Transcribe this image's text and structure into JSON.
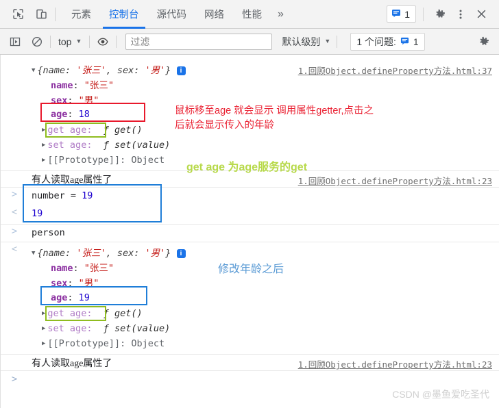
{
  "window": {
    "title": "Chrome DevTools Console"
  },
  "tabbar": {
    "inspect_icon": "inspect-element-icon",
    "device_icon": "device-toolbar-icon",
    "tabs": [
      {
        "label": "元素",
        "active": false
      },
      {
        "label": "控制台",
        "active": true
      },
      {
        "label": "源代码",
        "active": false
      },
      {
        "label": "网络",
        "active": false
      },
      {
        "label": "性能",
        "active": false
      }
    ],
    "more_label": "»",
    "message_count": "1",
    "settings_icon": "gear-icon",
    "menu_icon": "more-vertical-icon",
    "close_icon": "close-icon"
  },
  "filterbar": {
    "sidebar_toggle_icon": "show-console-sidebar-icon",
    "clear_icon": "clear-console-icon",
    "context_label": "top",
    "context_caret": "▼",
    "eye_icon": "live-expression-icon",
    "filter_placeholder": "过滤",
    "filter_value": "",
    "level_label": "默认级别",
    "level_caret": "▼",
    "issues_label": "1 个问题:",
    "issues_count": "1",
    "settings_icon": "gear-icon"
  },
  "console": {
    "entries": [
      {
        "type": "object-output",
        "preview_prefix": "{name: ",
        "preview_name": "'张三'",
        "preview_mid": ", sex: ",
        "preview_sex": "'男'",
        "preview_suffix": "}",
        "source_link": "1.回顾Object.defineProperty方法.html:37",
        "props": [
          {
            "key": "name",
            "sep": ": ",
            "value": "\"张三\"",
            "kind": "string"
          },
          {
            "key": "sex",
            "sep": ": ",
            "value": "\"男\"",
            "kind": "string"
          },
          {
            "key": "age",
            "sep": ": ",
            "value": "18",
            "kind": "number"
          },
          {
            "key": "get age",
            "sep": ": ",
            "value": "ƒ get()",
            "kind": "function"
          },
          {
            "key": "set age",
            "sep": ": ",
            "value": "ƒ set(value)",
            "kind": "function"
          },
          {
            "key": "[[Prototype]]",
            "sep": ": ",
            "value": "Object",
            "kind": "proto"
          }
        ]
      },
      {
        "type": "log",
        "text": "有人读取age属性了",
        "source_link": "1.回顾Object.defineProperty方法.html:23"
      },
      {
        "type": "input",
        "text_a": "number",
        "text_b": " = ",
        "text_c": "19"
      },
      {
        "type": "result",
        "value": "19"
      },
      {
        "type": "input",
        "text_a": "person",
        "text_b": "",
        "text_c": ""
      },
      {
        "type": "object-output",
        "preview_prefix": "{name: ",
        "preview_name": "'张三'",
        "preview_mid": ", sex: ",
        "preview_sex": "'男'",
        "preview_suffix": "}",
        "source_link": "",
        "props": [
          {
            "key": "name",
            "sep": ": ",
            "value": "\"张三\"",
            "kind": "string"
          },
          {
            "key": "sex",
            "sep": ": ",
            "value": "\"男\"",
            "kind": "string"
          },
          {
            "key": "age",
            "sep": ": ",
            "value": "19",
            "kind": "number"
          },
          {
            "key": "get age",
            "sep": ": ",
            "value": "ƒ get()",
            "kind": "function"
          },
          {
            "key": "set age",
            "sep": ": ",
            "value": "ƒ set(value)",
            "kind": "function"
          },
          {
            "key": "[[Prototype]]",
            "sep": ": ",
            "value": "Object",
            "kind": "proto"
          }
        ]
      },
      {
        "type": "log",
        "text": "有人读取age属性了",
        "source_link": "1.回顾Object.defineProperty方法.html:23"
      },
      {
        "type": "prompt",
        "marker": ">"
      }
    ],
    "markers": {
      "input": ">",
      "output": "<"
    }
  },
  "annotations": {
    "red_note": "鼠标移至age 就会显示 调用属性getter,点击之\n后就会显示传入的年龄",
    "green_note": "get age 为age服务的get",
    "blue_note": "修改年龄之后"
  },
  "colors": {
    "accent": "#1a73e8",
    "red_box": "#e8192c",
    "green_box": "#8fbc1f",
    "blue_box": "#1f7ed8",
    "string": "#c41a16",
    "number": "#1c00cf",
    "propname": "#8b2fa0"
  },
  "watermark": "CSDN @墨鱼爱吃圣代"
}
